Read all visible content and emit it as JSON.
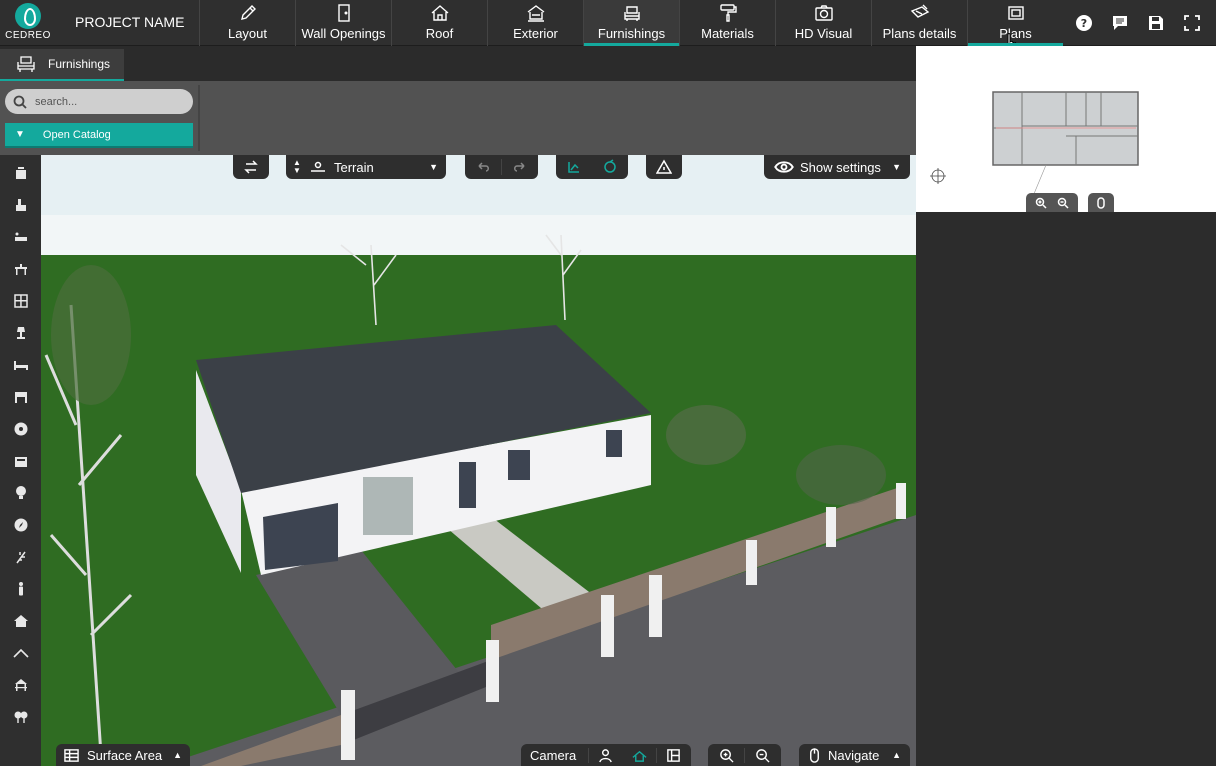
{
  "app": {
    "logo_text": "CEDREO",
    "project_name": "PROJECT NAME"
  },
  "nav": {
    "tabs": [
      {
        "label": "Layout",
        "icon": "pencil-icon"
      },
      {
        "label": "Wall Openings",
        "icon": "door-icon"
      },
      {
        "label": "Roof",
        "icon": "roof-icon"
      },
      {
        "label": "Exterior",
        "icon": "exterior-icon"
      },
      {
        "label": "Furnishings",
        "icon": "armchair-icon",
        "active": true
      },
      {
        "label": "Materials",
        "icon": "paint-roller-icon"
      },
      {
        "label": "HD Visual",
        "icon": "camera-icon"
      },
      {
        "label": "Plans details",
        "icon": "plans-details-icon"
      },
      {
        "label": "Plans",
        "icon": "plans-icon"
      }
    ],
    "right_icons": [
      "help-icon",
      "comment-icon",
      "save-icon",
      "fullscreen-icon"
    ]
  },
  "subbar": {
    "tab_label": "Furnishings"
  },
  "catalog": {
    "search_placeholder": "search...",
    "open_catalog_label": "Open Catalog"
  },
  "toolbar": {
    "terrain_label": "Terrain",
    "show_settings_label": "Show settings"
  },
  "bottom": {
    "surface_area_label": "Surface Area",
    "camera_label": "Camera",
    "navigate_label": "Navigate"
  },
  "left_tools": [
    "cabinet-icon",
    "tap-icon",
    "bath-icon",
    "dining-icon",
    "shelf-icon",
    "lamp-icon",
    "bed-icon",
    "kitchen-chair-icon",
    "ball-icon",
    "storage-icon",
    "bulb-icon",
    "compass-icon",
    "plant-icon",
    "person-icon",
    "house-icon",
    "slope-icon",
    "gazebo-icon",
    "trees-icon"
  ],
  "colors": {
    "accent": "#14a99d",
    "bar": "#2f2f2f",
    "sky": "#f2f6f7",
    "grass": "#2f6c22",
    "roof": "#3b4047"
  }
}
